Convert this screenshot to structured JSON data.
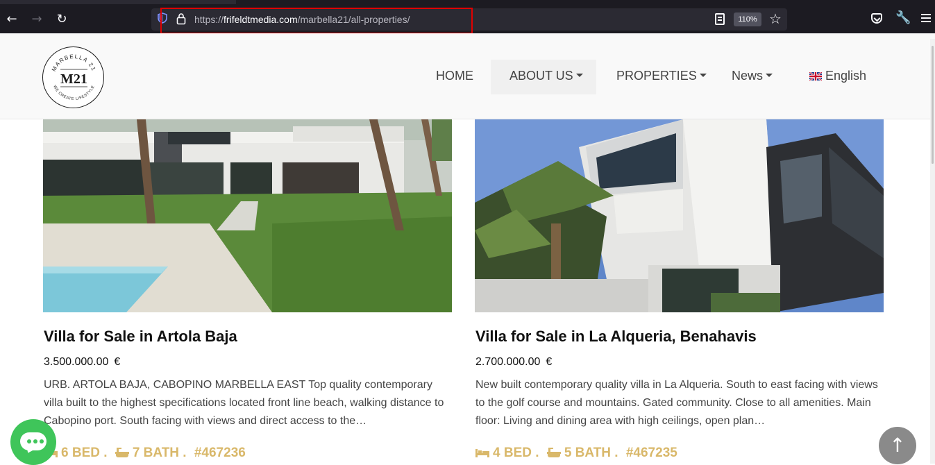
{
  "browser": {
    "url_prefix": "https://",
    "url_domain": "frifeldtmedia.com",
    "url_path": "/marbella21/all-properties/",
    "zoom": "110%"
  },
  "header": {
    "logo_top_text": "MARBELLA 21",
    "logo_center_text": "M21",
    "logo_bottom_text": "WE CREATE LIFESTYLE",
    "nav": {
      "home": "HOME",
      "about": "ABOUT US",
      "properties": "PROPERTIES",
      "news": "News",
      "language": "English"
    }
  },
  "listings": [
    {
      "title": "Villa for Sale in Artola Baja",
      "price": "3.500.000.00",
      "currency": "€",
      "description": "URB. ARTOLA BAJA, CABOPINO MARBELLA EAST Top quality contemporary villa built to the highest specifications located front line beach, walking distance to Cabopino port. South facing with views and direct access to the…",
      "beds": "6 BED .",
      "baths": "7 BATH .",
      "ref": "#467236"
    },
    {
      "title": "Villa for Sale in La Alqueria, Benahavis",
      "price": "2.700.000.00",
      "currency": "€",
      "description": "New built contemporary quality villa in La Alqueria. South to east facing with views to the golf course and mountains. Gated community. Close to all amenities. Main floor: Living and dining area with high ceilings, open plan…",
      "beds": "4 BED .",
      "baths": "5 BATH .",
      "ref": "#467235"
    }
  ],
  "colors": {
    "accent_gold": "#d9b86a",
    "chat_green": "#3fc55a",
    "url_highlight": "#e00000"
  }
}
